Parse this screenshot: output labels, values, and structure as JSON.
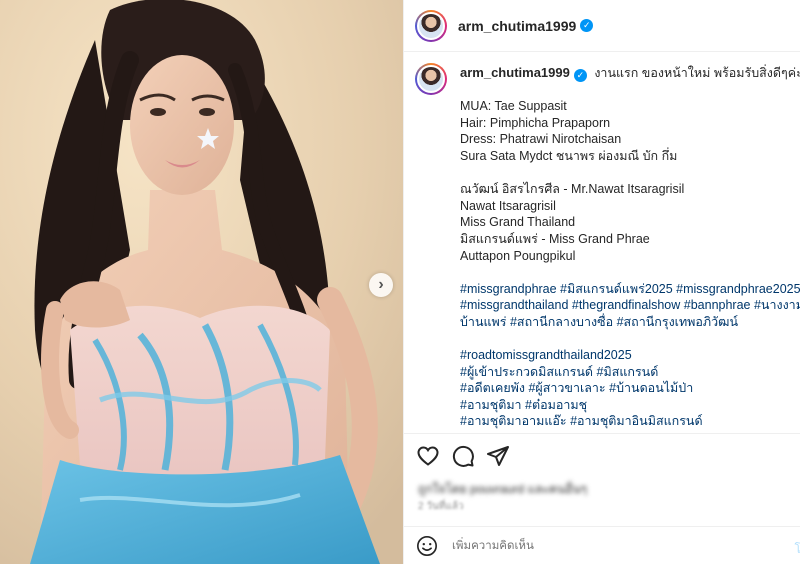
{
  "account": {
    "username": "arm_chutima1999",
    "verified_symbol": "✓"
  },
  "photo": {
    "subject": "woman in strapless blue sequined gown with hand on chest",
    "colors": {
      "background": "#ead3b3",
      "dress_pink": "#f1d5cf",
      "dress_blue": "#4fb2d9",
      "hair": "#231815"
    }
  },
  "caption": {
    "first_line": "งานแรก ของหน้าใหม่ พร้อมรับสิ่งดีๆค่ะ",
    "credits": [
      "MUA: Tae Suppasit",
      "Hair: Pimphicha Prapaporn",
      "Dress: Phatrawi Nirotchaisan",
      "Sura Sata Mydct ชนาพร ผ่องมณี บัก กึ่ม"
    ],
    "people": [
      "ณวัฒน์ อิสรไกรศีล - Mr.Nawat Itsaragrisil",
      "Nawat Itsaragrisil",
      "Miss Grand Thailand",
      "มิสแกรนด์แพร่ - Miss Grand Phrae",
      "Auttapon Poungpikul"
    ],
    "hashtags_1": [
      "#missgrandphrae #มิสแกรนด์แพร่2025 #missgrandphrae2025",
      "#missgrandthailand #thegrandfinalshow #bannphrae #นางงาม",
      "บ้านแพร่ #สถานีกลางบางซื่อ #สถานีกรุงเทพอภิวัฒน์"
    ],
    "hashtags_2": [
      "#roadtomissgrandthailand2025",
      "#ผู้เข้าประกวดมิสแกรนด์ #มิสแกรนด์",
      "#อดีตเคยพัง #ผู้สาวขาเลาะ #บ้านดอนไม้ป่า",
      "#อามชุติมา #ต๋อมอามชุ",
      "#อามชุติมาอามแอ๊ะ #อามชุติมาอินมิสแกรนด์"
    ]
  },
  "actions": {
    "icons": [
      "heart-icon",
      "comment-icon",
      "share-icon"
    ]
  },
  "likes_text": "ถูกใจโดย pouvraurd และคนอื่นๆ",
  "time_ago": "2 วันที่แล้ว",
  "comment": {
    "placeholder": "เพิ่มความคิดเห็น",
    "post_label": "โ"
  },
  "carousel": {
    "next_symbol": "›"
  }
}
